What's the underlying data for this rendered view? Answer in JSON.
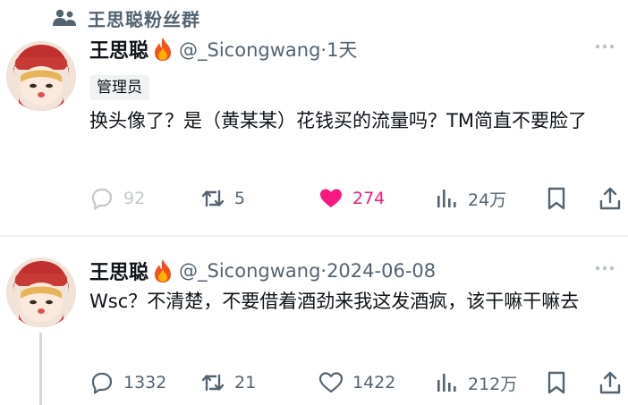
{
  "community": {
    "name": "王思聪粉丝群",
    "icon": "people-icon"
  },
  "posts": [
    {
      "display_name": "王思聪",
      "name_emoji": "fire-icon",
      "handle_date": "@_Sicongwang·1天",
      "badge": "管理员",
      "text": "换头像了？是（黄某某）花钱买的流量吗？TM简直不要脸了",
      "replies": "92",
      "reposts": "5",
      "likes": "274",
      "views": "24万",
      "liked": true,
      "like_color": "#f91880"
    },
    {
      "display_name": "王思聪",
      "name_emoji": "fire-icon",
      "handle_date": "@_Sicongwang·2024-06-08",
      "text": "Wsc？不清楚，不要借着酒劲来我这发酒疯，该干嘛干嘛去",
      "replies": "1332",
      "reposts": "21",
      "likes": "1422",
      "views": "212万",
      "liked": false
    }
  ]
}
